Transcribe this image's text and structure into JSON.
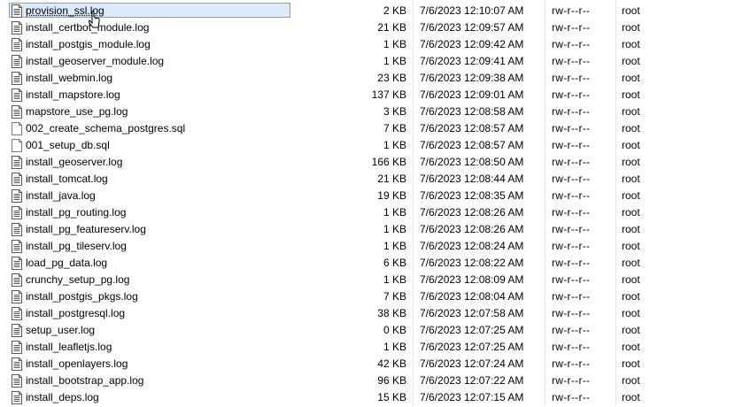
{
  "files": [
    {
      "name": "provision_ssl.log",
      "size": "2 KB",
      "date": "7/6/2023 12:10:07 AM",
      "perms": "rw-r--r--",
      "owner": "root",
      "icon": "text-file-icon",
      "selected": true
    },
    {
      "name": "install_certbot_module.log",
      "size": "21 KB",
      "date": "7/6/2023 12:09:57 AM",
      "perms": "rw-r--r--",
      "owner": "root",
      "icon": "text-file-icon"
    },
    {
      "name": "install_postgis_module.log",
      "size": "1 KB",
      "date": "7/6/2023 12:09:42 AM",
      "perms": "rw-r--r--",
      "owner": "root",
      "icon": "text-file-icon"
    },
    {
      "name": "install_geoserver_module.log",
      "size": "1 KB",
      "date": "7/6/2023 12:09:41 AM",
      "perms": "rw-r--r--",
      "owner": "root",
      "icon": "text-file-icon"
    },
    {
      "name": "install_webmin.log",
      "size": "23 KB",
      "date": "7/6/2023 12:09:38 AM",
      "perms": "rw-r--r--",
      "owner": "root",
      "icon": "text-file-icon"
    },
    {
      "name": "install_mapstore.log",
      "size": "137 KB",
      "date": "7/6/2023 12:09:01 AM",
      "perms": "rw-r--r--",
      "owner": "root",
      "icon": "text-file-icon"
    },
    {
      "name": "mapstore_use_pg.log",
      "size": "3 KB",
      "date": "7/6/2023 12:08:58 AM",
      "perms": "rw-r--r--",
      "owner": "root",
      "icon": "text-file-icon"
    },
    {
      "name": "002_create_schema_postgres.sql",
      "size": "7 KB",
      "date": "7/6/2023 12:08:57 AM",
      "perms": "rw-r--r--",
      "owner": "root",
      "icon": "blank-file-icon"
    },
    {
      "name": "001_setup_db.sql",
      "size": "1 KB",
      "date": "7/6/2023 12:08:57 AM",
      "perms": "rw-r--r--",
      "owner": "root",
      "icon": "blank-file-icon"
    },
    {
      "name": "install_geoserver.log",
      "size": "166 KB",
      "date": "7/6/2023 12:08:50 AM",
      "perms": "rw-r--r--",
      "owner": "root",
      "icon": "text-file-icon"
    },
    {
      "name": "install_tomcat.log",
      "size": "21 KB",
      "date": "7/6/2023 12:08:44 AM",
      "perms": "rw-r--r--",
      "owner": "root",
      "icon": "text-file-icon"
    },
    {
      "name": "install_java.log",
      "size": "19 KB",
      "date": "7/6/2023 12:08:35 AM",
      "perms": "rw-r--r--",
      "owner": "root",
      "icon": "text-file-icon"
    },
    {
      "name": "install_pg_routing.log",
      "size": "1 KB",
      "date": "7/6/2023 12:08:26 AM",
      "perms": "rw-r--r--",
      "owner": "root",
      "icon": "text-file-icon"
    },
    {
      "name": "install_pg_featureserv.log",
      "size": "1 KB",
      "date": "7/6/2023 12:08:26 AM",
      "perms": "rw-r--r--",
      "owner": "root",
      "icon": "text-file-icon"
    },
    {
      "name": "install_pg_tileserv.log",
      "size": "1 KB",
      "date": "7/6/2023 12:08:24 AM",
      "perms": "rw-r--r--",
      "owner": "root",
      "icon": "text-file-icon"
    },
    {
      "name": "load_pg_data.log",
      "size": "6 KB",
      "date": "7/6/2023 12:08:22 AM",
      "perms": "rw-r--r--",
      "owner": "root",
      "icon": "text-file-icon"
    },
    {
      "name": "crunchy_setup_pg.log",
      "size": "1 KB",
      "date": "7/6/2023 12:08:09 AM",
      "perms": "rw-r--r--",
      "owner": "root",
      "icon": "text-file-icon"
    },
    {
      "name": "install_postgis_pkgs.log",
      "size": "7 KB",
      "date": "7/6/2023 12:08:04 AM",
      "perms": "rw-r--r--",
      "owner": "root",
      "icon": "text-file-icon"
    },
    {
      "name": "install_postgresql.log",
      "size": "38 KB",
      "date": "7/6/2023 12:07:58 AM",
      "perms": "rw-r--r--",
      "owner": "root",
      "icon": "text-file-icon"
    },
    {
      "name": "setup_user.log",
      "size": "0 KB",
      "date": "7/6/2023 12:07:25 AM",
      "perms": "rw-r--r--",
      "owner": "root",
      "icon": "text-file-icon"
    },
    {
      "name": "install_leafletjs.log",
      "size": "1 KB",
      "date": "7/6/2023 12:07:25 AM",
      "perms": "rw-r--r--",
      "owner": "root",
      "icon": "text-file-icon"
    },
    {
      "name": "install_openlayers.log",
      "size": "42 KB",
      "date": "7/6/2023 12:07:24 AM",
      "perms": "rw-r--r--",
      "owner": "root",
      "icon": "text-file-icon"
    },
    {
      "name": "install_bootstrap_app.log",
      "size": "96 KB",
      "date": "7/6/2023 12:07:22 AM",
      "perms": "rw-r--r--",
      "owner": "root",
      "icon": "text-file-icon"
    },
    {
      "name": "install_deps.log",
      "size": "15 KB",
      "date": "7/6/2023 12:07:15 AM",
      "perms": "rw-r--r--",
      "owner": "root",
      "icon": "text-file-icon"
    }
  ]
}
